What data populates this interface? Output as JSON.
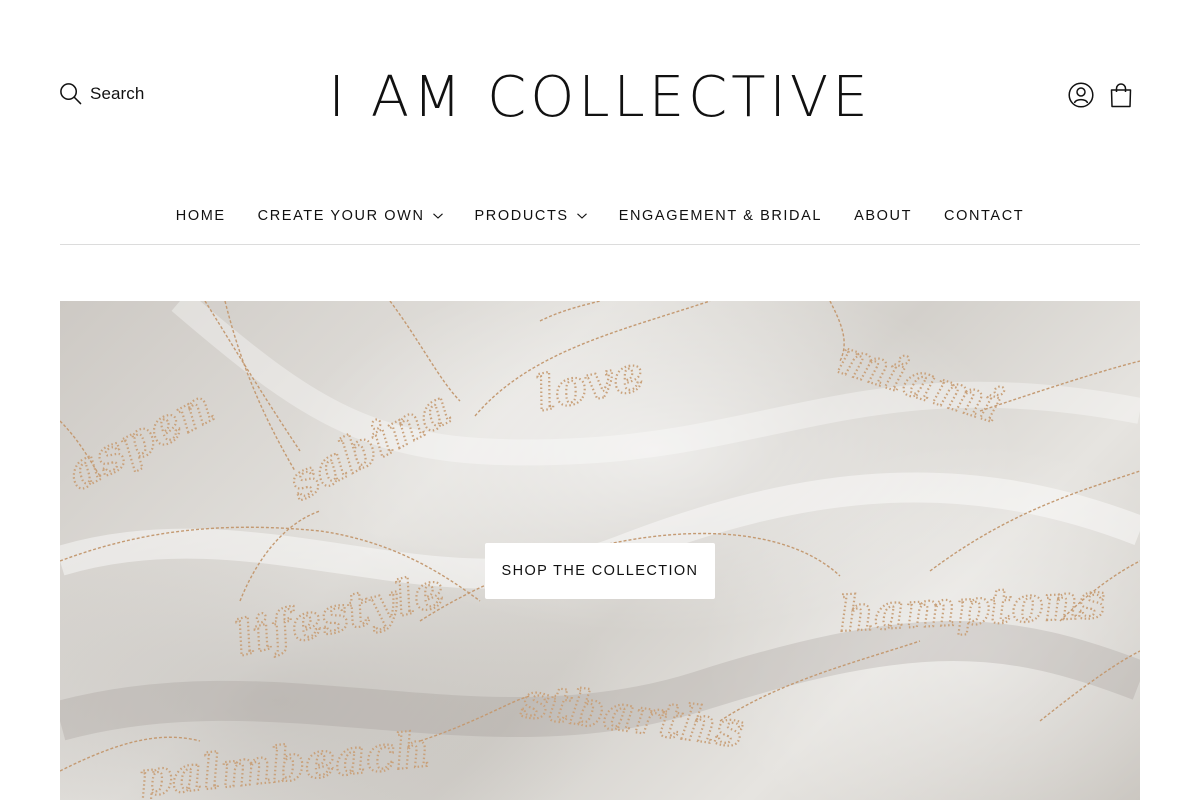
{
  "header": {
    "search_label": "Search",
    "logo": "I AM COLLECTIVE",
    "icons": {
      "search": "search-icon",
      "account": "account-icon",
      "cart": "shopping-bag-icon"
    }
  },
  "nav": {
    "items": [
      {
        "label": "HOME",
        "has_dropdown": false
      },
      {
        "label": "CREATE YOUR OWN",
        "has_dropdown": true
      },
      {
        "label": "PRODUCTS",
        "has_dropdown": true
      },
      {
        "label": "ENGAGEMENT & BRIDAL",
        "has_dropdown": false
      },
      {
        "label": "ABOUT",
        "has_dropdown": false
      },
      {
        "label": "CONTACT",
        "has_dropdown": false
      }
    ]
  },
  "hero": {
    "cta_label": "SHOP THE COLLECTION",
    "image_words": [
      "aspen",
      "sabina",
      "love",
      "miami",
      "lifestyle",
      "hamptons",
      "stbarths",
      "palmbeach"
    ]
  },
  "colors": {
    "text": "#111111",
    "divider": "#dcdcdc",
    "gold": "#c9a27c",
    "background": "#ffffff"
  }
}
